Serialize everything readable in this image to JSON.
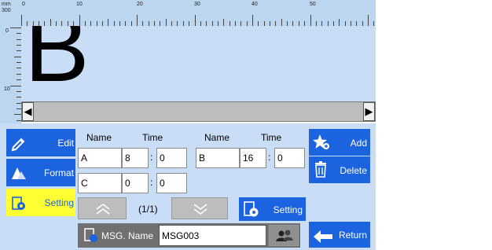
{
  "ruler": {
    "unit_top": "mm",
    "unit_bottom": "300",
    "top_labels": [
      "0",
      "10",
      "20",
      "30",
      "40",
      "50"
    ],
    "left_labels": [
      "0",
      "10"
    ]
  },
  "canvas": {
    "letter": "B"
  },
  "scrollbar": {
    "left_glyph": "◀",
    "right_glyph": "▶"
  },
  "sidebar": {
    "edit": "Edit",
    "format": "Format",
    "setting": "Setting"
  },
  "table": {
    "headers": [
      "Name",
      "Time",
      "Name",
      "Time"
    ],
    "rows": [
      [
        {
          "name": "A",
          "h": "8",
          "m": "0"
        },
        {
          "name": "B",
          "h": "16",
          "m": "0"
        }
      ],
      [
        {
          "name": "C",
          "h": "0",
          "m": "0"
        }
      ]
    ],
    "colon": ":"
  },
  "pager": {
    "label": "(1/1)"
  },
  "setting_button": "Setting",
  "msg": {
    "label": "MSG. Name",
    "value": "MSG003"
  },
  "actions": {
    "add": "Add",
    "delete": "Delete",
    "return": "Return"
  },
  "colors": {
    "accent": "#1c63e0",
    "selected": "#ffff33",
    "panel_bg": "#c9def6",
    "ruler_bg": "#bcd6ef"
  }
}
